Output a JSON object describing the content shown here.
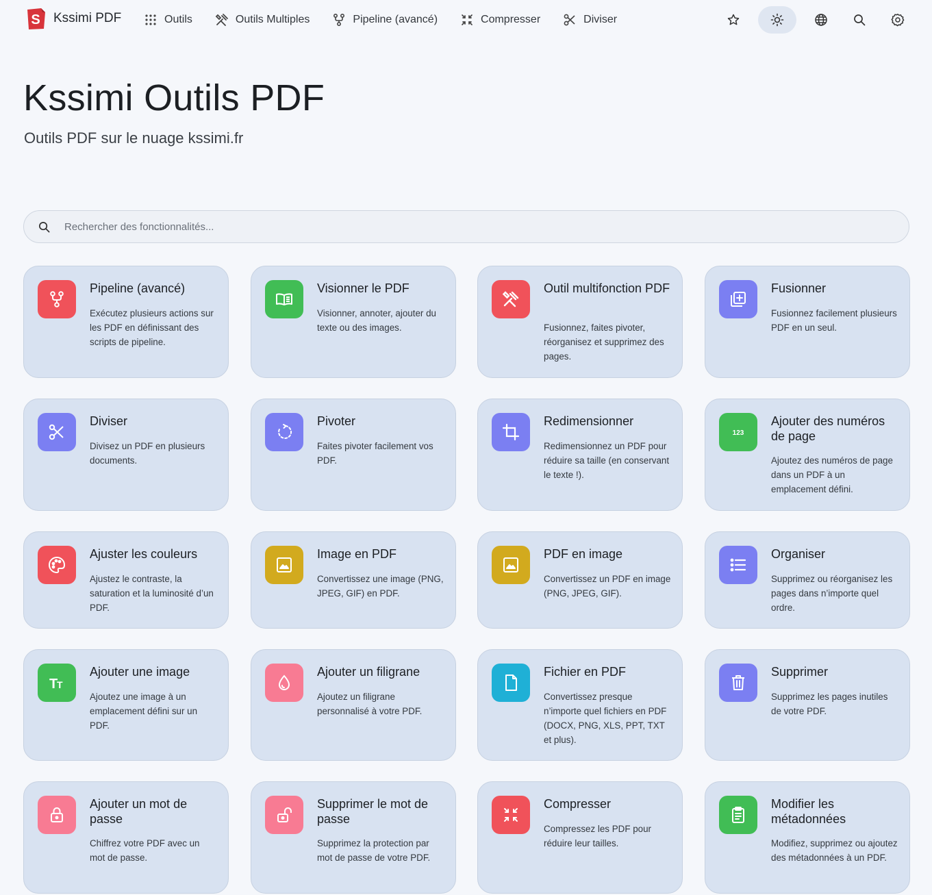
{
  "brand": {
    "name": "Kssimi PDF"
  },
  "nav": {
    "links": [
      {
        "label": "Outils",
        "icon": "grid-dots-icon"
      },
      {
        "label": "Outils Multiples",
        "icon": "tools-icon"
      },
      {
        "label": "Pipeline (avancé)",
        "icon": "pipeline-icon"
      },
      {
        "label": "Compresser",
        "icon": "compress-icon"
      },
      {
        "label": "Diviser",
        "icon": "scissors-icon"
      }
    ],
    "icons": [
      "star-icon",
      "sun-icon",
      "globe-icon",
      "search-icon",
      "gear-icon"
    ]
  },
  "hero": {
    "title": "Kssimi Outils PDF",
    "subtitle": "Outils PDF sur le nuage kssimi.fr"
  },
  "search": {
    "placeholder": "Rechercher des fonctionnalités..."
  },
  "colors": {
    "red": "#f0525a",
    "green": "#41bd55",
    "purple": "#7b7ff2",
    "yellow": "#d2aa1e",
    "pink": "#f87b93",
    "cyan": "#1fb0d6"
  },
  "cards": [
    {
      "title": "Pipeline (avancé)",
      "desc": "Exécutez plusieurs actions sur les PDF en définissant des scripts de pipeline.",
      "color": "#f0525a",
      "icon": "pipeline-icon"
    },
    {
      "title": "Visionner le PDF",
      "desc": "Visionner, annoter, ajouter du texte ou des images.",
      "color": "#41bd55",
      "icon": "book-icon"
    },
    {
      "title": "Outil multifonction PDF",
      "desc": "Fusionnez, faites pivoter, réorganisez et supprimez des pages.",
      "color": "#f0525a",
      "icon": "tools-icon"
    },
    {
      "title": "Fusionner",
      "desc": "Fusionnez facilement plusieurs PDF en un seul.",
      "color": "#7b7ff2",
      "icon": "merge-icon"
    },
    {
      "title": "Diviser",
      "desc": "Divisez un PDF en plusieurs documents.",
      "color": "#7b7ff2",
      "icon": "scissors-icon"
    },
    {
      "title": "Pivoter",
      "desc": "Faites pivoter facilement vos PDF.",
      "color": "#7b7ff2",
      "icon": "rotate-icon"
    },
    {
      "title": "Redimensionner",
      "desc": "Redimensionnez un PDF pour réduire sa taille (en conservant le texte !).",
      "color": "#7b7ff2",
      "icon": "crop-icon"
    },
    {
      "title": "Ajouter des numéros de page",
      "desc": "Ajoutez des numéros de page dans un PDF à un emplacement défini.",
      "color": "#41bd55",
      "icon": "numbers-icon"
    },
    {
      "title": "Ajuster les couleurs",
      "desc": "Ajustez le contraste, la saturation et la luminosité d’un PDF.",
      "color": "#f0525a",
      "icon": "palette-icon"
    },
    {
      "title": "Image en PDF",
      "desc": "Convertissez une image (PNG, JPEG, GIF) en PDF.",
      "color": "#d2aa1e",
      "icon": "image-icon"
    },
    {
      "title": "PDF en image",
      "desc": "Convertissez un PDF en image (PNG, JPEG, GIF).",
      "color": "#d2aa1e",
      "icon": "image-icon"
    },
    {
      "title": "Organiser",
      "desc": "Supprimez ou réorganisez les pages dans n’importe quel ordre.",
      "color": "#7b7ff2",
      "icon": "list-icon"
    },
    {
      "title": "Ajouter une image",
      "desc": "Ajoutez une image à un emplacement défini sur un PDF.",
      "color": "#41bd55",
      "icon": "text-size-icon"
    },
    {
      "title": "Ajouter un filigrane",
      "desc": "Ajoutez un filigrane personnalisé à votre PDF.",
      "color": "#f87b93",
      "icon": "droplet-icon"
    },
    {
      "title": "Fichier en PDF",
      "desc": "Convertissez presque n’importe quel fichiers en PDF (DOCX, PNG, XLS, PPT, TXT et plus).",
      "color": "#1fb0d6",
      "icon": "file-icon"
    },
    {
      "title": "Supprimer",
      "desc": "Supprimez les pages inutiles de votre PDF.",
      "color": "#7b7ff2",
      "icon": "trash-icon"
    },
    {
      "title": "Ajouter un mot de passe",
      "desc": "Chiffrez votre PDF avec un mot de passe.",
      "color": "#f87b93",
      "icon": "lock-icon"
    },
    {
      "title": "Supprimer le mot de passe",
      "desc": "Supprimez la protection par mot de passe de votre PDF.",
      "color": "#f87b93",
      "icon": "unlock-icon"
    },
    {
      "title": "Compresser",
      "desc": "Compressez les PDF pour réduire leur tailles.",
      "color": "#f0525a",
      "icon": "compress-icon"
    },
    {
      "title": "Modifier les métadonnées",
      "desc": "Modifiez, supprimez ou ajoutez des métadonnées à un PDF.",
      "color": "#41bd55",
      "icon": "clipboard-icon"
    }
  ]
}
